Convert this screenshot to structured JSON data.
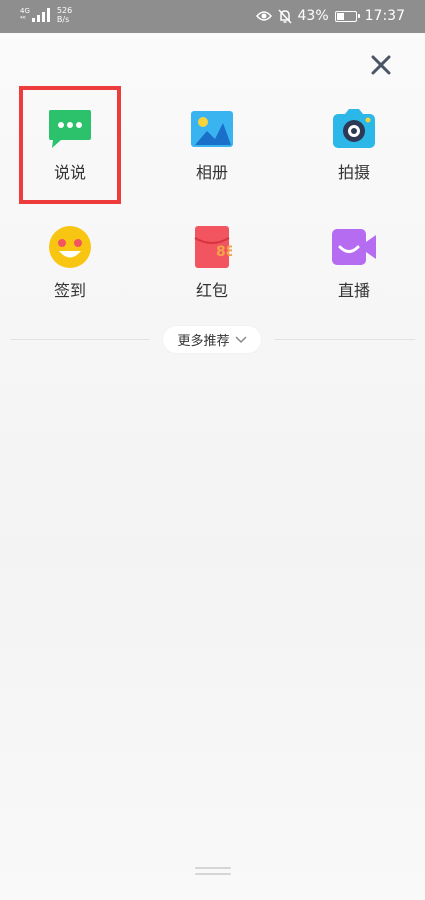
{
  "status_bar": {
    "network_type_top": "4G",
    "network_type_bottom": "⁴⁶",
    "net_speed_value": "526",
    "net_speed_unit": "B/s",
    "battery_percent": "43%",
    "battery_level": 0.43,
    "time": "17:37"
  },
  "panel": {
    "close_icon": "close-icon",
    "actions": [
      {
        "label": "说说",
        "icon": "chat-bubble-icon",
        "color": "#2cc16b"
      },
      {
        "label": "相册",
        "icon": "photo-album-icon",
        "color": "#39b4f0"
      },
      {
        "label": "拍摄",
        "icon": "camera-icon",
        "color": "#2bb8e8"
      },
      {
        "label": "签到",
        "icon": "smiley-icon",
        "color": "#f9c513"
      },
      {
        "label": "红包",
        "icon": "red-packet-icon",
        "color": "#f2555f"
      },
      {
        "label": "直播",
        "icon": "live-video-icon",
        "color": "#b66cf0"
      }
    ],
    "more_label": "更多推荐",
    "highlight_color": "#ee3b3b"
  }
}
